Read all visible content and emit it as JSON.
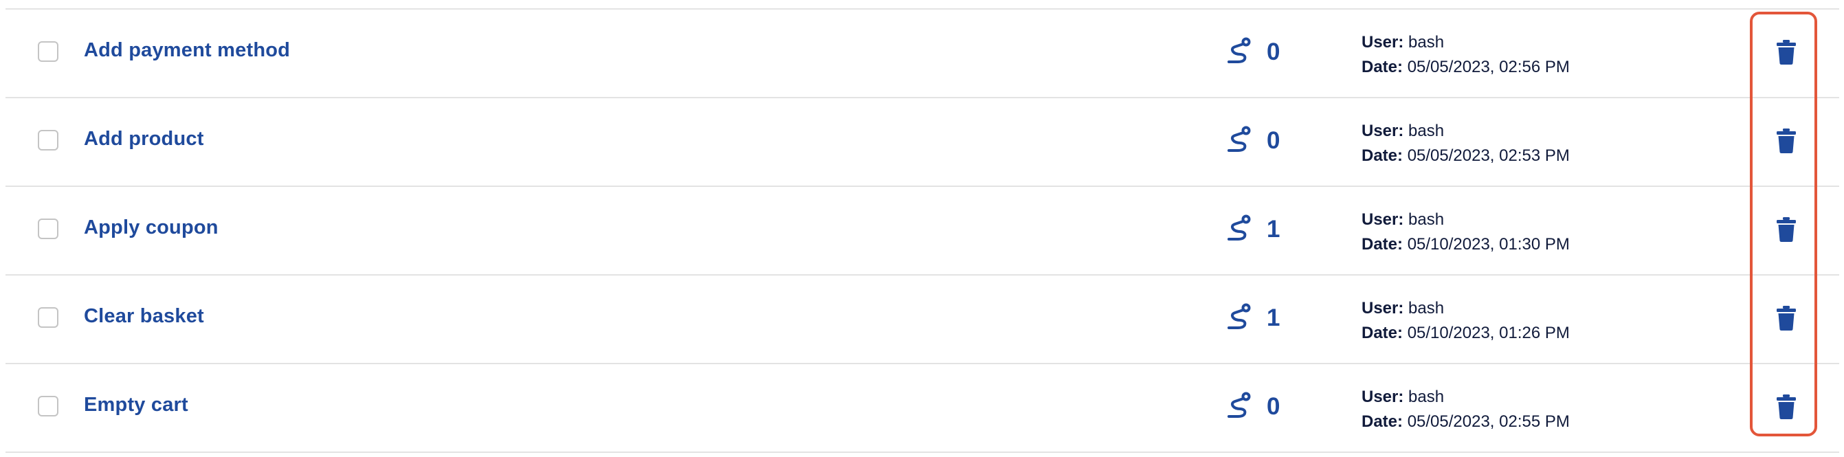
{
  "rows": [
    {
      "name": "Add payment method",
      "steps": "0",
      "user_label": "User:",
      "user": "bash",
      "date_label": "Date:",
      "date": "05/05/2023, 02:56 PM"
    },
    {
      "name": "Add product",
      "steps": "0",
      "user_label": "User:",
      "user": "bash",
      "date_label": "Date:",
      "date": "05/05/2023, 02:53 PM"
    },
    {
      "name": "Apply coupon",
      "steps": "1",
      "user_label": "User:",
      "user": "bash",
      "date_label": "Date:",
      "date": "05/10/2023, 01:30 PM"
    },
    {
      "name": "Clear basket",
      "steps": "1",
      "user_label": "User:",
      "user": "bash",
      "date_label": "Date:",
      "date": "05/10/2023, 01:26 PM"
    },
    {
      "name": "Empty cart",
      "steps": "0",
      "user_label": "User:",
      "user": "bash",
      "date_label": "Date:",
      "date": "05/05/2023, 02:55 PM"
    }
  ],
  "icons": {
    "steps": "route-icon",
    "delete": "trash-icon"
  },
  "colors": {
    "accent": "#1f4a9c",
    "text": "#111b3b",
    "divider": "#e3e3e3",
    "highlight": "#e3563a"
  }
}
